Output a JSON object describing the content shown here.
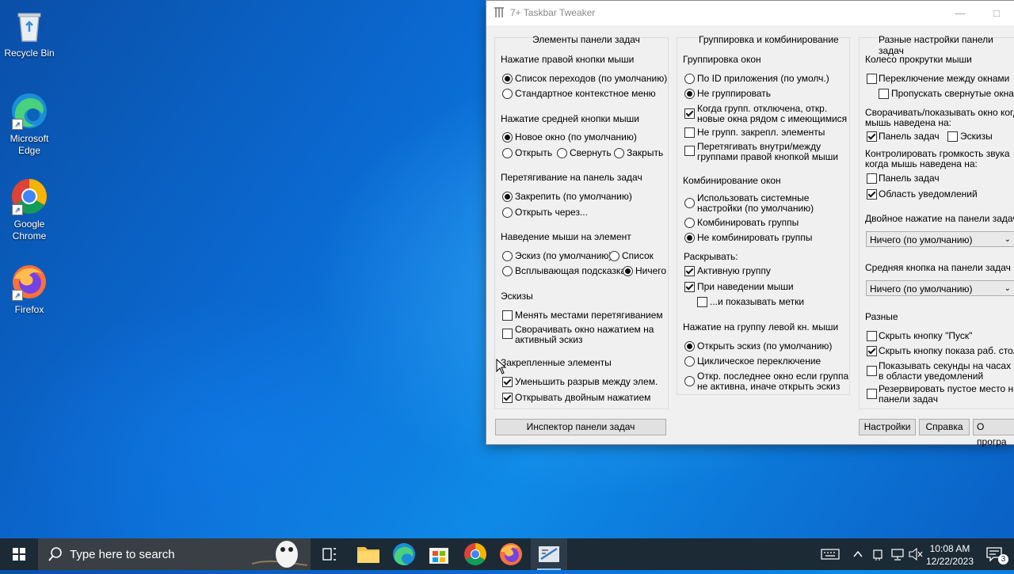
{
  "desktop": {
    "icons": [
      {
        "label": "Recycle Bin"
      },
      {
        "label": "Microsoft Edge"
      },
      {
        "label": "Google Chrome"
      },
      {
        "label": "Firefox"
      }
    ]
  },
  "window": {
    "title": "7+ Taskbar Tweaker",
    "col1": {
      "title": "Элементы панели задач",
      "right_click": {
        "label": "Нажатие правой кнопки мыши",
        "opt1": "Список переходов (по умолчанию)",
        "opt2": "Стандартное контекстное меню"
      },
      "middle_click": {
        "label": "Нажатие средней кнопки мыши",
        "opt1": "Новое окно (по умолчанию)",
        "opt2": "Открыть",
        "opt3": "Свернуть",
        "opt4": "Закрыть"
      },
      "drop": {
        "label": "Перетягивание на панель задач",
        "opt1": "Закрепить (по умолчанию)",
        "opt2": "Открыть через..."
      },
      "hover": {
        "label": "Наведение мыши на элемент",
        "opt1": "Эскиз (по умолчанию)",
        "opt2": "Список",
        "opt3": "Всплывающая подсказка",
        "opt4": "Ничего"
      },
      "thumbs": {
        "label": "Эскизы",
        "opt1": "Менять местами перетягиванием",
        "opt2a": "Сворачивать окно нажатием на",
        "opt2b": "активный эскиз"
      },
      "pinned": {
        "label": "Закрепленные элементы",
        "opt1": "Уменьшить разрыв между элем.",
        "opt2": "Открывать двойным нажатием"
      },
      "inspector_button": "Инспектор панели задач"
    },
    "col2": {
      "title": "Группировка и комбинирование",
      "grouping": {
        "label": "Группировка окон",
        "opt1": "По ID приложения (по умолч.)",
        "opt2": "Не группировать",
        "chk1a": "Когда групп. отключена, откр.",
        "chk1b": "новые окна рядом с имеющимися",
        "chk2": "Не групп. закрепл. элементы",
        "chk3a": "Перетягивать внутри/между",
        "chk3b": "группами правой кнопкой мыши"
      },
      "combining": {
        "label": "Комбинирование окон",
        "opt1a": "Использовать системные",
        "opt1b": "настройки (по умолчанию)",
        "opt2": "Комбинировать группы",
        "opt3": "Не комбинировать группы",
        "expand_label": "Раскрывать:",
        "chk1": "Активную группу",
        "chk2": "При наведении мыши",
        "chk3": "...и показывать метки"
      },
      "left_click": {
        "label": "Нажатие на группу левой кн. мыши",
        "opt1": "Открыть эскиз (по умолчанию)",
        "opt2": "Циклическое переключение",
        "opt3a": "Откр. последнее окно если группа",
        "opt3b": "не активна, иначе открыть эскиз"
      }
    },
    "col3": {
      "title": "Разные настройки панели задач",
      "wheel": {
        "label": "Колесо прокрутки мыши",
        "chk1": "Переключение между окнами",
        "chk2": "Пропускать свернутые окна",
        "minimize_label_a": "Сворачивать/показывать окно когда",
        "minimize_label_b": "мышь наведена на:",
        "chk3": "Панель задач",
        "chk4": "Эскизы",
        "volume_label_a": "Контролировать громкость звука",
        "volume_label_b": "когда мышь наведена на:",
        "chk5": "Панель задач",
        "chk6": "Область уведомлений"
      },
      "double_click": {
        "label": "Двойное нажатие на панели задач",
        "value": "Ничего (по умолчанию)"
      },
      "middle_button": {
        "label": "Средняя кнопка на панели задач",
        "value": "Ничего (по умолчанию)"
      },
      "misc": {
        "label": "Разные",
        "chk1": "Скрыть кнопку \"Пуск\"",
        "chk2": "Скрыть кнопку показа раб. стола",
        "chk3a": "Показывать секунды на часах",
        "chk3b": "в области уведомлений",
        "chk4a": "Резервировать пустое место на",
        "chk4b": "панели задач"
      },
      "settings_button": "Настройки",
      "help_button": "Справка",
      "about_button": "О програ"
    }
  },
  "taskbar": {
    "search_placeholder": "Type here to search",
    "clock_time": "10:08 AM",
    "clock_date": "12/22/2023",
    "notification_count": "3"
  }
}
